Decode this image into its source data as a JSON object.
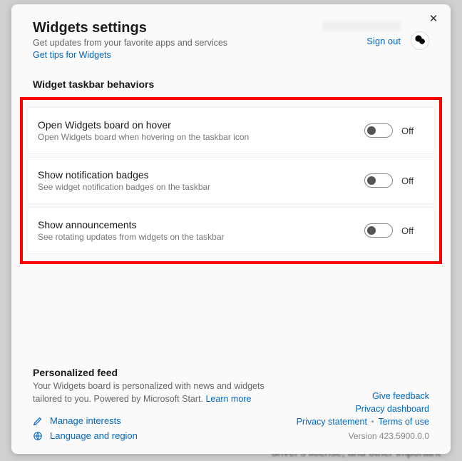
{
  "header": {
    "title": "Widgets settings",
    "subtitle": "Get updates from your favorite apps and services",
    "tips_link": "Get tips for Widgets",
    "signout": "Sign out"
  },
  "section_behaviors_title": "Widget taskbar behaviors",
  "behaviors": [
    {
      "label": "Open Widgets board on hover",
      "desc": "Open Widgets board when hovering on the taskbar icon",
      "state": "Off"
    },
    {
      "label": "Show notification badges",
      "desc": "See widget notification badges on the taskbar",
      "state": "Off"
    },
    {
      "label": "Show announcements",
      "desc": "See rotating updates from widgets on the taskbar",
      "state": "Off"
    }
  ],
  "feed": {
    "title": "Personalized feed",
    "desc_a": "Your Widgets board is personalized with news and widgets tailored to you. Powered by Microsoft Start. ",
    "learn_more": "Learn more",
    "manage_interests": "Manage interests",
    "language_region": "Language and region"
  },
  "footer_links": {
    "give_feedback": "Give feedback",
    "privacy_dashboard": "Privacy dashboard",
    "privacy_statement": "Privacy statement",
    "terms_of_use": "Terms of use",
    "version": "Version 423.5900.0.0"
  }
}
